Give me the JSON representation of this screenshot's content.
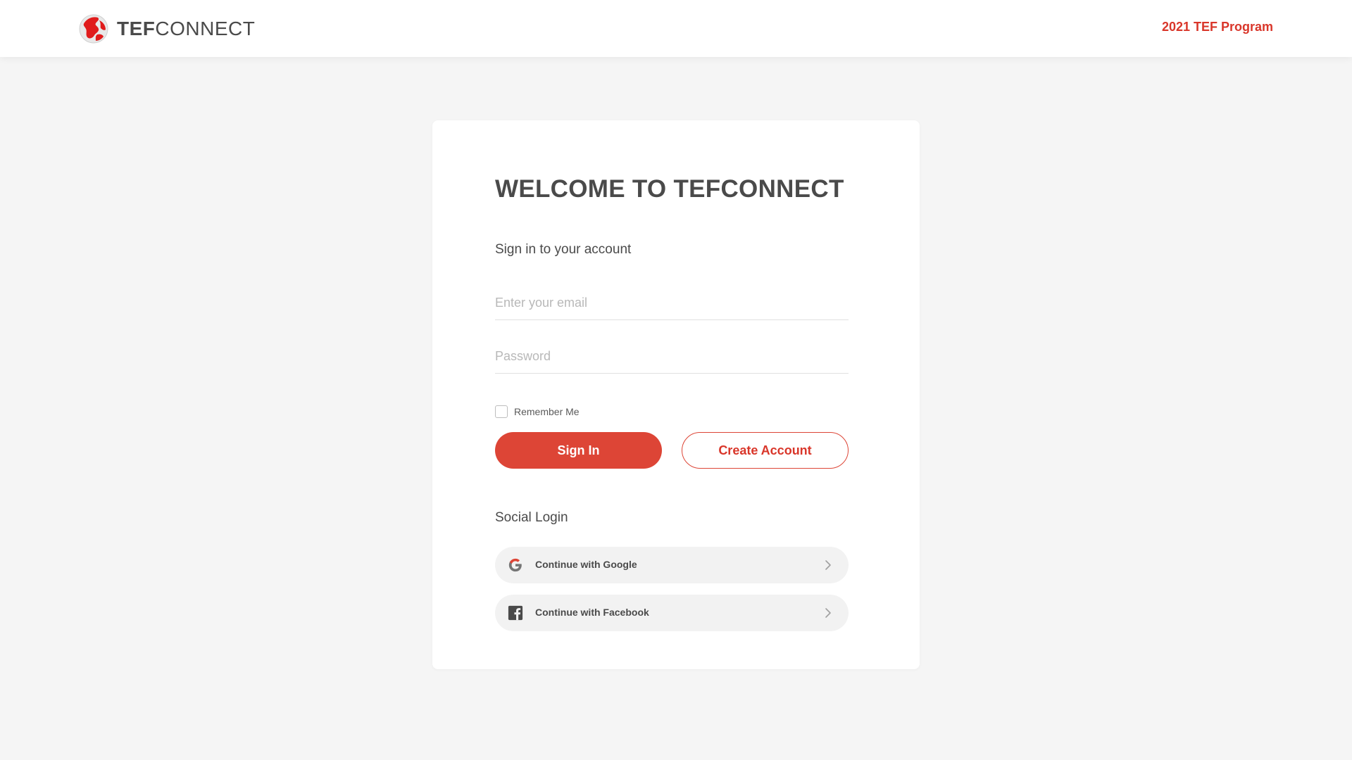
{
  "header": {
    "logo_bold": "TEF",
    "logo_light": "CONNECT",
    "program_link": "2021 TEF Program"
  },
  "login": {
    "title": "WELCOME TO TEFCONNECT",
    "subtitle": "Sign in to your account",
    "email_placeholder": "Enter your email",
    "email_value": "",
    "password_placeholder": "Password",
    "password_value": "",
    "remember_label": "Remember Me",
    "remember_checked": false,
    "signin_label": "Sign In",
    "create_label": "Create Account"
  },
  "social": {
    "title": "Social Login",
    "google_label": "Continue with Google",
    "facebook_label": "Continue with Facebook"
  },
  "icons": {
    "logo": "globe-icon",
    "google": "google-icon",
    "facebook": "facebook-icon",
    "chevron": "chevron-right-icon"
  },
  "colors": {
    "accent": "#dd4536",
    "accent_text": "#d9362a",
    "page_bg": "#f5f5f5",
    "card_bg": "#ffffff",
    "text": "#4a4a4a",
    "social_bg": "#f2f2f2"
  }
}
